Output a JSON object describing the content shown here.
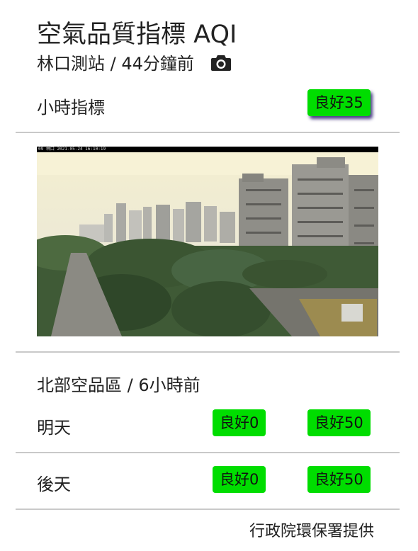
{
  "header": {
    "title": "空氣品質指標 AQI",
    "station_line": "林口測站 / 44分鐘前",
    "camera_icon": "camera-icon"
  },
  "hourly": {
    "label": "小時指標",
    "badge": "良好35"
  },
  "webcam": {
    "overlay_text": "09 林口 2021-05-24 16:10:19"
  },
  "forecast": {
    "region_line": "北部空品區 / 6小時前",
    "rows": [
      {
        "label": "明天",
        "low": "良好0",
        "high": "良好50"
      },
      {
        "label": "後天",
        "low": "良好0",
        "high": "良好50"
      }
    ]
  },
  "footer": {
    "credit": "行政院環保署提供"
  },
  "colors": {
    "good": "#00dd00",
    "divider": "#c9c9c9",
    "text": "#222222"
  }
}
